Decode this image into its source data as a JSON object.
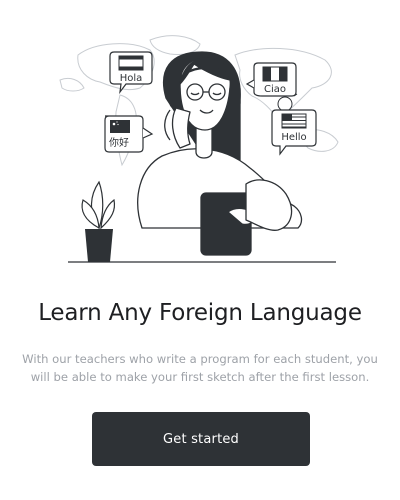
{
  "onboarding": {
    "bubbles": {
      "hola": "Hola",
      "ciao": "Ciao",
      "nihao": "你好",
      "hello": "Hello"
    },
    "title": "Learn Any Foreign Language",
    "description": "With our teachers who write a program for each student, you will be able to make your first sketch after the first lesson.",
    "cta_label": "Get started"
  },
  "colors": {
    "ink": "#2e3236",
    "title": "#1e1f22",
    "muted_text": "#9ea2a8",
    "button_bg": "#2e3236",
    "button_text": "#ffffff"
  },
  "icons": [
    "spain-flag-icon",
    "italy-flag-icon",
    "china-flag-icon",
    "usa-flag-icon",
    "world-map",
    "headphones-icon",
    "tablet-icon",
    "potted-plant-icon",
    "lightbulb-icon"
  ]
}
